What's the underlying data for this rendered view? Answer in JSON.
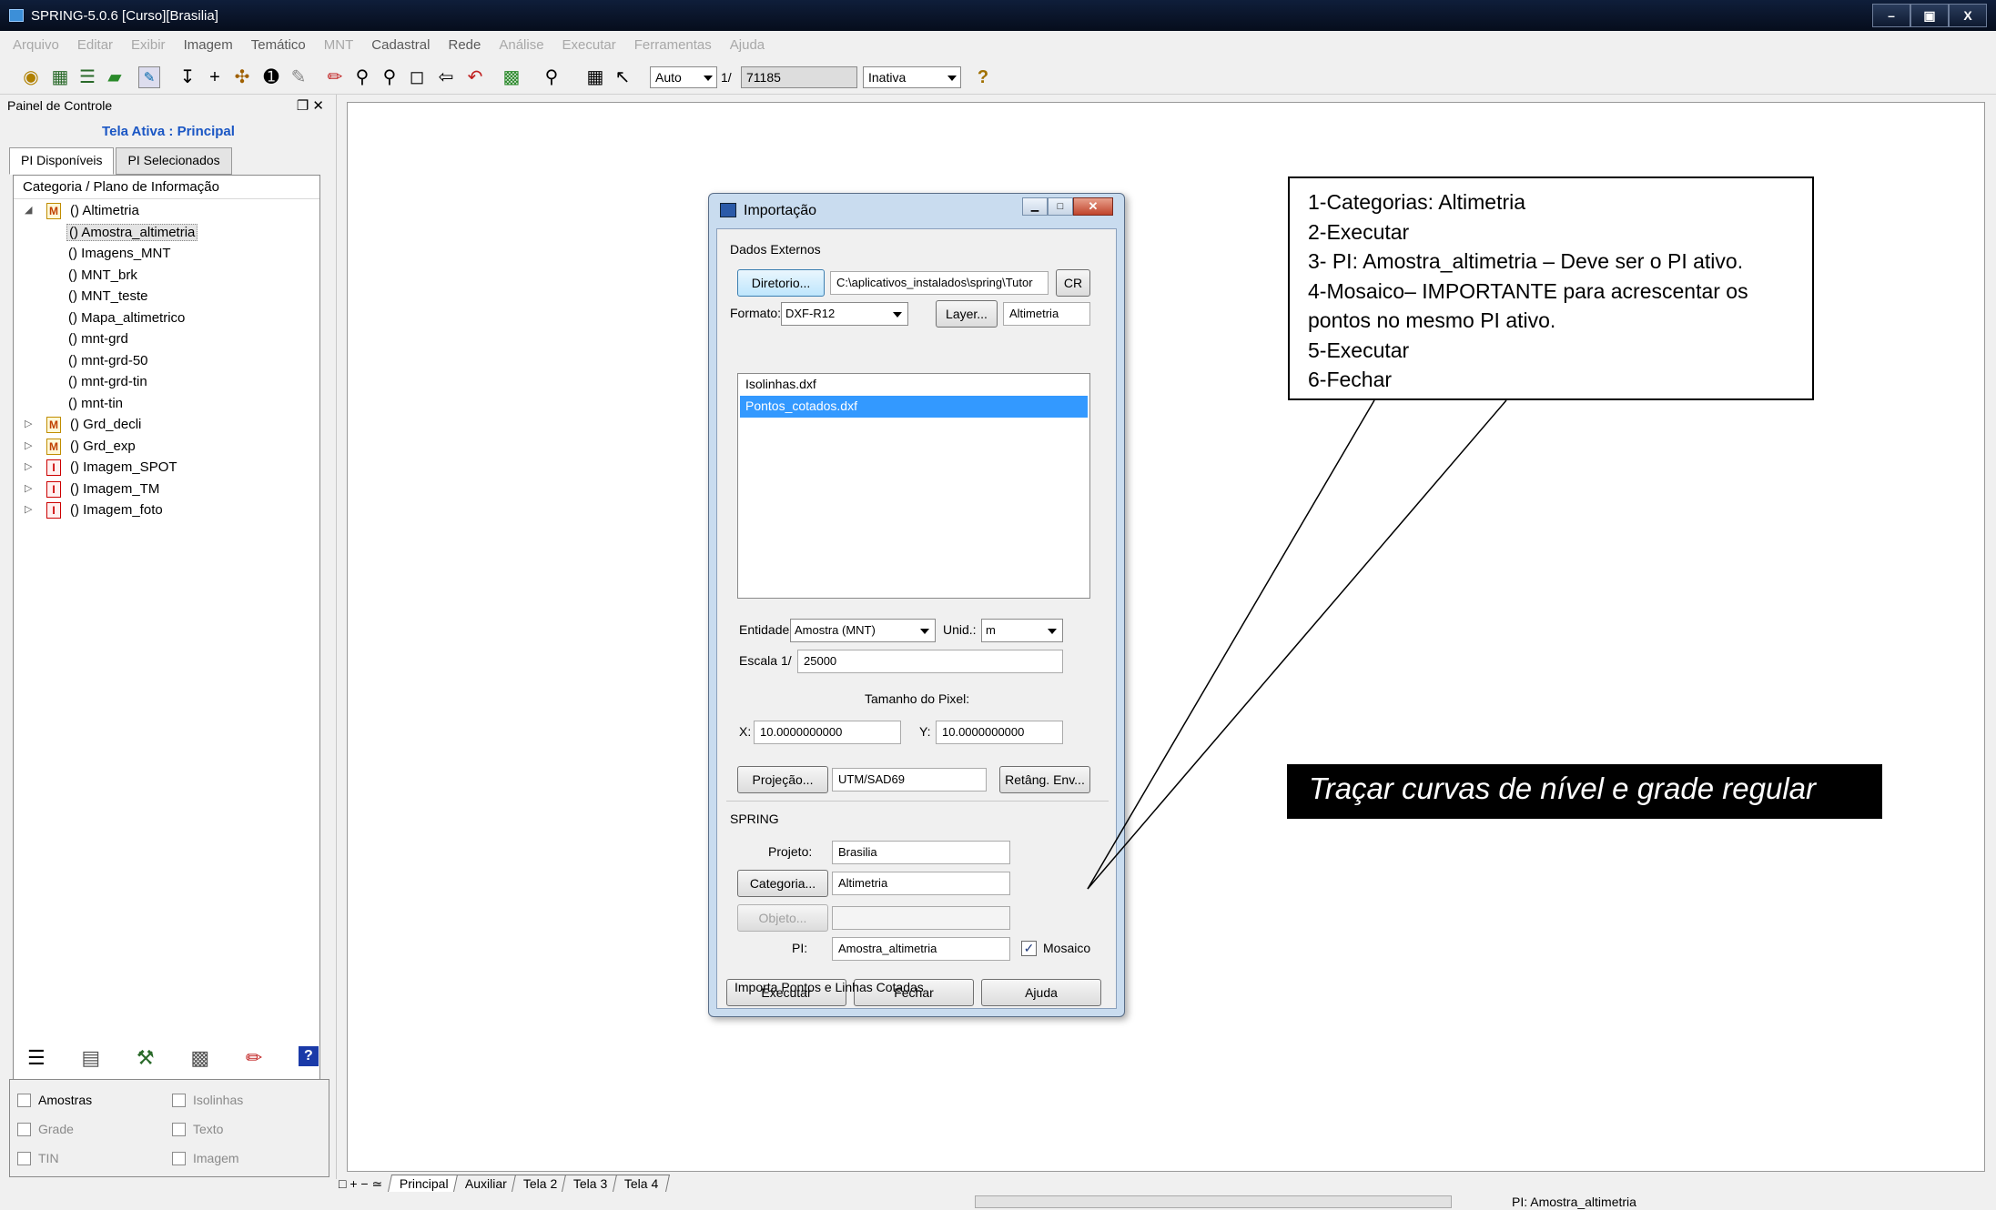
{
  "app": {
    "title": "SPRING-5.0.6 [Curso][Brasilia]",
    "window_buttons": [
      "–",
      "▣",
      "X"
    ]
  },
  "menu": [
    "Arquivo",
    "Editar",
    "Exibir",
    "Imagem",
    "Temático",
    "MNT",
    "Cadastral",
    "Rede",
    "Análise",
    "Executar",
    "Ferramentas",
    "Ajuda"
  ],
  "toolbar": {
    "auto": "Auto",
    "scale_prefix": "1/",
    "scale_value": "71185",
    "state": "Inativa",
    "help_icon": "?"
  },
  "panel": {
    "title": "Painel de Controle",
    "header_buttons": "❐ ✕",
    "tela_ativa": "Tela Ativa : Principal",
    "tabs": [
      "PI Disponíveis",
      "PI Selecionados"
    ],
    "tree_header": "Categoria / Plano de Informação",
    "tree": [
      {
        "exp": "◢",
        "badge": "M",
        "label": "() Altimetria"
      },
      {
        "label": "() Amostra_altimetria",
        "selected": true
      },
      {
        "label": "() Imagens_MNT"
      },
      {
        "label": "() MNT_brk"
      },
      {
        "label": "() MNT_teste"
      },
      {
        "label": "() Mapa_altimetrico"
      },
      {
        "label": "() mnt-grd"
      },
      {
        "label": "() mnt-grd-50"
      },
      {
        "label": "() mnt-grd-tin"
      },
      {
        "label": "() mnt-tin"
      },
      {
        "exp": "▷",
        "badge": "M",
        "label": "() Grd_decli"
      },
      {
        "exp": "▷",
        "badge": "M",
        "label": "() Grd_exp"
      },
      {
        "exp": "▷",
        "badge": "I",
        "label": "() Imagem_SPOT"
      },
      {
        "exp": "▷",
        "badge": "I",
        "label": "() Imagem_TM"
      },
      {
        "exp": "▷",
        "badge": "I",
        "label": "() Imagem_foto"
      }
    ],
    "checkboxes": {
      "amostras": "Amostras",
      "isolinhas": "Isolinhas",
      "grade": "Grade",
      "texto": "Texto",
      "tin": "TIN",
      "imagem": "Imagem"
    }
  },
  "bottom_tabs": [
    "Principal",
    "Auxiliar",
    "Tela 2",
    "Tela 3",
    "Tela 4"
  ],
  "bottom_icons": "□ + − ≃",
  "status": {
    "pi": "PI: Amostra_altimetria"
  },
  "dialog": {
    "title": "Importação",
    "dados_externos": "Dados Externos",
    "diretorio_btn": "Diretorio...",
    "path": "C:\\aplicativos_instalados\\spring\\Tutor",
    "cr_btn": "CR",
    "formato_label": "Formato:",
    "formato_value": "DXF-R12",
    "layer_btn": "Layer...",
    "layer_value": "Altimetria",
    "files": [
      "Isolinhas.dxf",
      "Pontos_cotados.dxf"
    ],
    "entidade_label": "Entidade:",
    "entidade_value": "Amostra (MNT)",
    "unid_label": "Unid.:",
    "unid_value": "m",
    "escala_label": "Escala",
    "escala_prefix": "1/",
    "escala_value": "25000",
    "pixel_label": "Tamanho do Pixel:",
    "x_label": "X:",
    "x_value": "10.0000000000",
    "y_label": "Y:",
    "y_value": "10.0000000000",
    "projecao_btn": "Projeção...",
    "projecao_value": "UTM/SAD69",
    "retang_btn": "Retâng. Env...",
    "spring_group": "SPRING",
    "projeto_label": "Projeto:",
    "projeto_value": "Brasilia",
    "categoria_btn": "Categoria...",
    "categoria_value": "Altimetria",
    "objeto_btn": "Objeto...",
    "pi_label": "PI:",
    "pi_value": "Amostra_altimetria",
    "mosaico_label": "Mosaico",
    "mosaico_checked": "✓",
    "executar_btn": "Executar",
    "fechar_btn": "Fechar",
    "ajuda_btn": "Ajuda",
    "status": "Importa Pontos e Linhas Cotadas"
  },
  "callout": {
    "lines": [
      "1-Categorias: Altimetria",
      "2-Executar",
      "3- PI: Amostra_altimetria – Deve ser o PI ativo.",
      "4-Mosaico– IMPORTANTE para acrescentar os",
      "pontos no mesmo PI ativo.",
      "5-Executar",
      "6-Fechar"
    ]
  },
  "banner": "Traçar curvas de nível e grade regular"
}
